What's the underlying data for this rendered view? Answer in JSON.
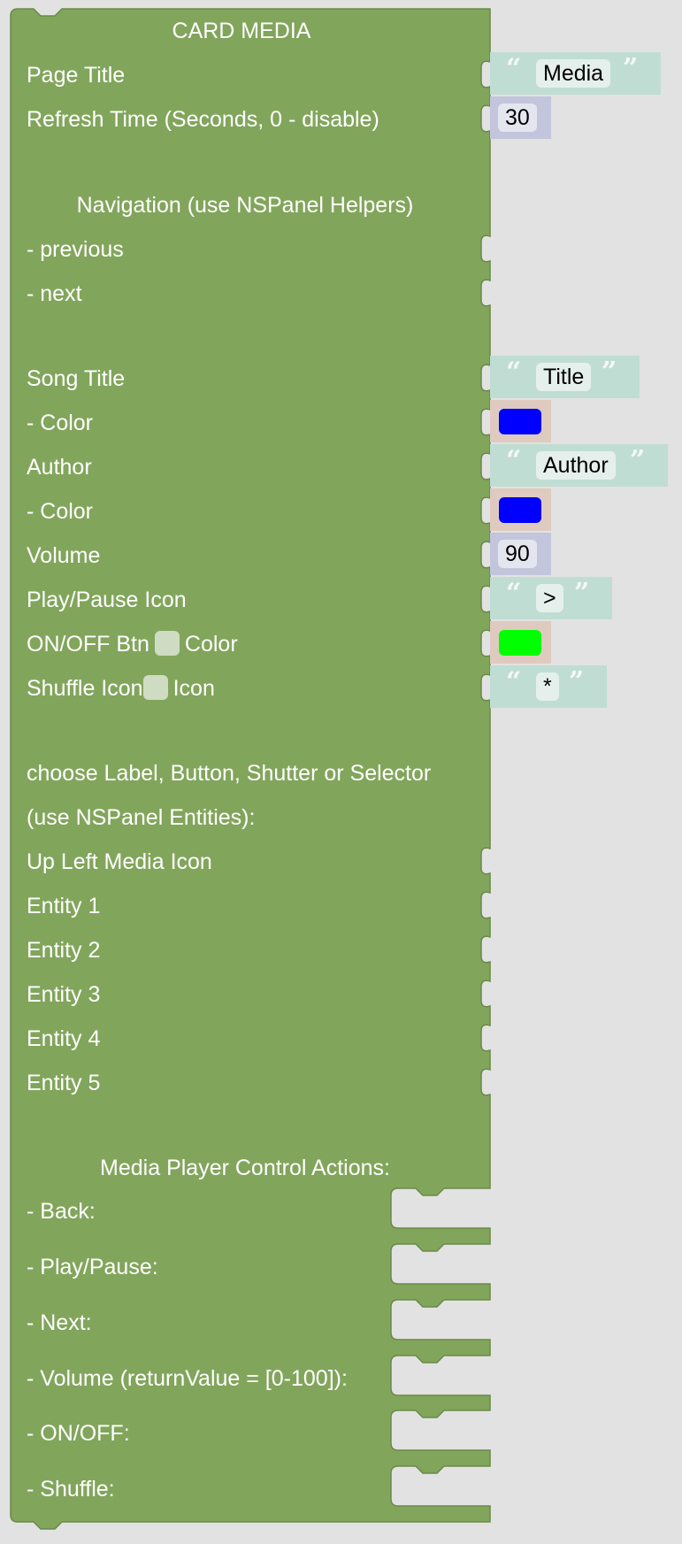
{
  "block": {
    "title": "CARD MEDIA",
    "colour": "#82a55c",
    "rows": {
      "page_title": "Page Title",
      "refresh_time": "Refresh Time (Seconds, 0 - disable)",
      "navigation_header": "Navigation (use NSPanel Helpers)",
      "nav_previous": "- previous",
      "nav_next": "- next",
      "song_title": "Song Title",
      "song_title_color": "- Color",
      "author": "Author",
      "author_color": "- Color",
      "volume": "Volume",
      "play_pause_icon": "Play/Pause Icon",
      "onoff_btn_prefix": "ON/OFF Btn",
      "onoff_btn_suffix": "Color",
      "shuffle_icon_prefix": "Shuffle Icon",
      "shuffle_icon_suffix": "Icon",
      "entities_header_1": "choose Label, Button, Shutter or Selector",
      "entities_header_2": "(use NSPanel Entities):",
      "up_left_media_icon": "Up Left Media Icon",
      "entity_1": "Entity 1",
      "entity_2": "Entity 2",
      "entity_3": "Entity 3",
      "entity_4": "Entity 4",
      "entity_5": "Entity 5",
      "actions_header": "Media Player Control Actions:",
      "action_back": "- Back:",
      "action_play_pause": "- Play/Pause:",
      "action_next": "- Next:",
      "action_volume": "- Volume (returnValue = [0-100]):",
      "action_onoff": "- ON/OFF:",
      "action_shuffle": "- Shuffle:"
    },
    "checkboxes": {
      "onoff_btn_checked": false,
      "shuffle_icon_checked": false
    }
  },
  "inputs": {
    "page_title_value": "Media",
    "refresh_time_value": "30",
    "song_title_value": "Title",
    "song_title_color": "#0000ff",
    "author_value": "Author",
    "author_color": "#0000ff",
    "volume_value": "90",
    "play_pause_icon_value": ">",
    "onoff_btn_color": "#00ff00",
    "shuffle_icon_value": "*"
  },
  "glyphs": {
    "open_quote": "“",
    "close_quote": "”"
  }
}
